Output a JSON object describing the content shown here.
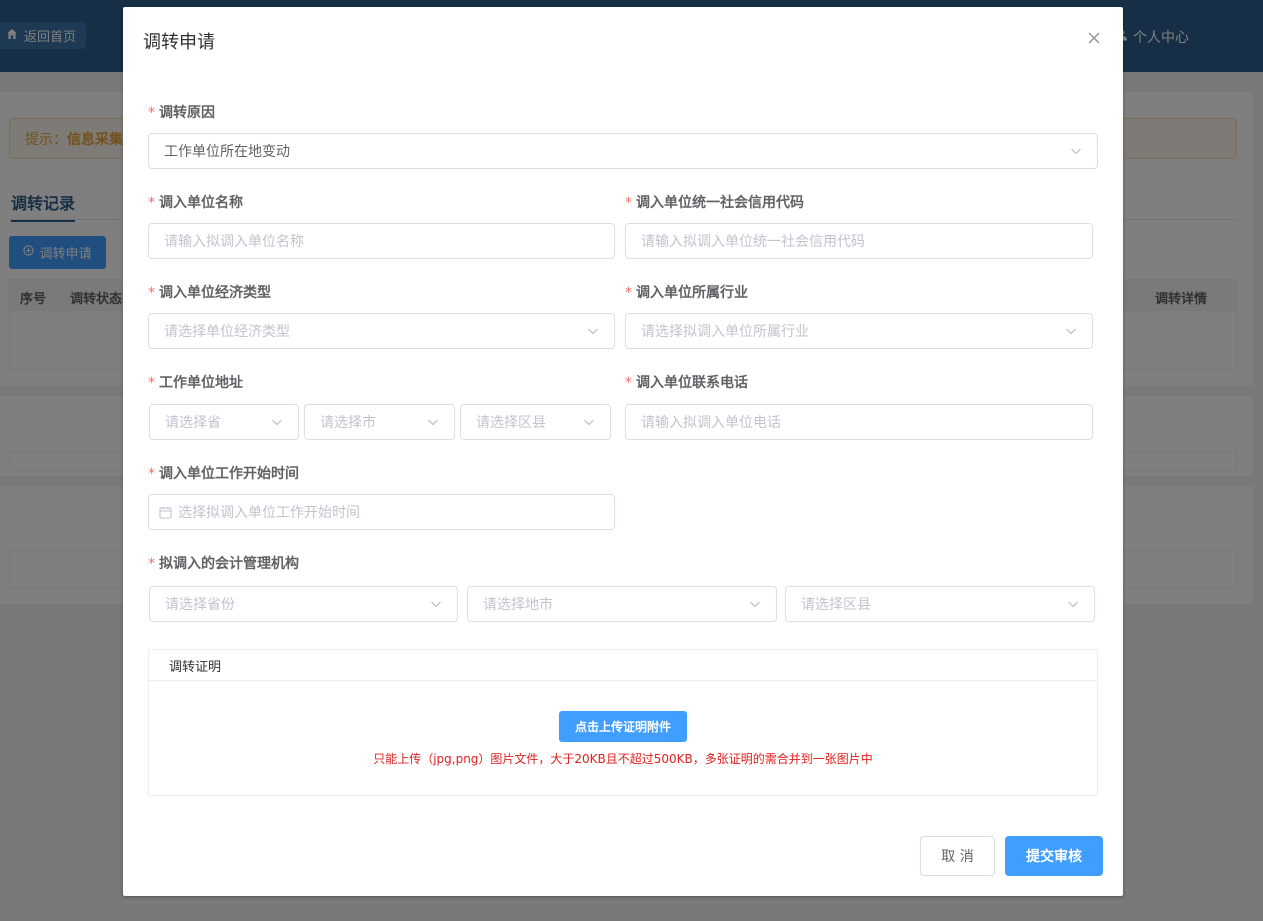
{
  "background": {
    "home_button": "返回首页",
    "user_center": "个人中心",
    "notice_prefix": "提示：",
    "notice_text": "信息采集",
    "tab_title": "调转记录",
    "apply_button": "调转申请",
    "table_headers": {
      "index": "序号",
      "status": "调转状态",
      "detail": "调转详情"
    }
  },
  "dialog": {
    "title": "调转申请",
    "fields": {
      "reason": {
        "label": "调转原因",
        "value": "工作单位所在地变动"
      },
      "unit_name": {
        "label": "调入单位名称",
        "placeholder": "请输入拟调入单位名称"
      },
      "credit_code": {
        "label": "调入单位统一社会信用代码",
        "placeholder": "请输入拟调入单位统一社会信用代码"
      },
      "economic_type": {
        "label": "调入单位经济类型",
        "placeholder": "请选择单位经济类型"
      },
      "industry": {
        "label": "调入单位所属行业",
        "placeholder": "请选择拟调入单位所属行业"
      },
      "address": {
        "label": "工作单位地址",
        "province_placeholder": "请选择省",
        "city_placeholder": "请选择市",
        "district_placeholder": "请选择区县"
      },
      "phone": {
        "label": "调入单位联系电话",
        "placeholder": "请输入拟调入单位电话"
      },
      "start_time": {
        "label": "调入单位工作开始时间",
        "placeholder": "选择拟调入单位工作开始时间"
      },
      "accounting_org": {
        "label": "拟调入的会计管理机构",
        "province_placeholder": "请选择省份",
        "city_placeholder": "请选择地市",
        "district_placeholder": "请选择区县"
      }
    },
    "upload": {
      "section_title": "调转证明",
      "button": "点击上传证明附件",
      "tip": "只能上传（jpg,png）图片文件，大于20KB且不超过500KB，多张证明的需合并到一张图片中"
    },
    "buttons": {
      "cancel": "取 消",
      "submit": "提交审核"
    }
  },
  "colors": {
    "header": "#2d5f8c",
    "primary": "#409eff",
    "required": "#f56c6c",
    "warning_text": "#e6a23c",
    "tip_text": "#e02020"
  }
}
